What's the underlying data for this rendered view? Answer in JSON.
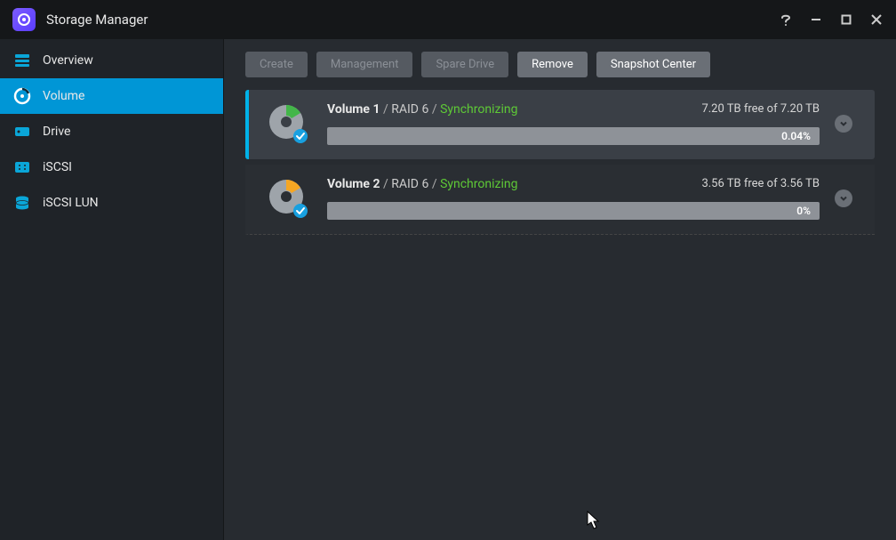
{
  "window": {
    "title": "Storage Manager"
  },
  "sidebar": {
    "items": [
      {
        "label": "Overview"
      },
      {
        "label": "Volume"
      },
      {
        "label": "Drive"
      },
      {
        "label": "iSCSI"
      },
      {
        "label": "iSCSI LUN"
      }
    ]
  },
  "toolbar": {
    "create": "Create",
    "management": "Management",
    "spare": "Spare Drive",
    "remove": "Remove",
    "snapshot": "Snapshot Center"
  },
  "volumes": [
    {
      "name": "Volume 1",
      "raid": "RAID 6",
      "status": "Synchronizing",
      "free_text": "7.20 TB free of 7.20 TB",
      "percent_text": "0.04%",
      "icon_accent": "green"
    },
    {
      "name": "Volume 2",
      "raid": "RAID 6",
      "status": "Synchronizing",
      "free_text": "3.56 TB free of 3.56 TB",
      "percent_text": "0%",
      "icon_accent": "orange"
    }
  ]
}
